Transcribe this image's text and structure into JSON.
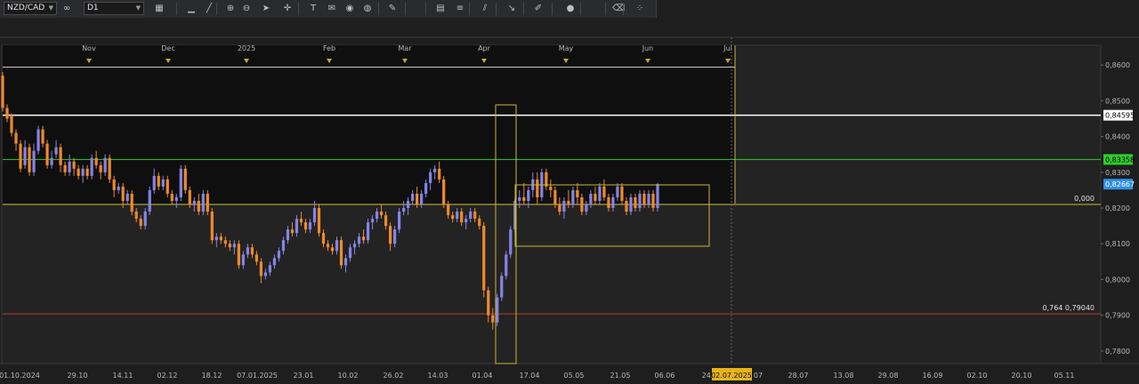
{
  "toolbar": {
    "symbol": "NZD/CAD",
    "timeframe": "D1",
    "icons": [
      "chart-type-icon",
      "line-tool-icon",
      "trendline-icon",
      "zoom-in-icon",
      "zoom-out-icon",
      "cursor-icon",
      "crosshair-icon",
      "text-icon",
      "note-icon",
      "color-icon",
      "globe-icon",
      "pencil-icon",
      "template-icon",
      "fibonacci-icon",
      "channel-icon",
      "arrow-icon",
      "pen-icon",
      "circle-icon",
      "eraser-icon",
      "indicator-icon"
    ]
  },
  "colors": {
    "background": "#1e1e1e",
    "bull": "#8484e8",
    "bear": "#ef8a2a",
    "white_line": "#ffffff",
    "green_line": "#2ecc2e",
    "red_line": "#c0392b",
    "yellow": "#c9b73a",
    "blue_label": "#2f8fe8"
  },
  "top_axis": [
    "Nov",
    "Dec",
    "2025",
    "Feb",
    "Mar",
    "Apr",
    "May",
    "Jun",
    "Jul"
  ],
  "bottom_axis": [
    "01.10.2024",
    "29.10",
    "14.11",
    "02.12",
    "18.12",
    "07.01.2025",
    "23.01",
    "10.02",
    "26.02",
    "14.03",
    "01.04",
    "17.04",
    "05.05",
    "21.05",
    "06.06",
    "24.",
    "07",
    "28.07",
    "13.08",
    "29.08",
    "16.09",
    "02.10",
    "20.10",
    "05.11"
  ],
  "cursor_date": "02.07.2025",
  "price_labels": [
    "0,8600",
    "0,8500",
    "0,8400",
    "0,8300",
    "0,8200",
    "0,8100",
    "0,8000",
    "0,7900",
    "0,7800"
  ],
  "level_labels": {
    "white": "0,84595",
    "green": "0,83358",
    "current": "0,82667",
    "zero": "0,000",
    "fib": "0,764 0,79040"
  },
  "chart_data": {
    "type": "candlestick",
    "symbol": "NZD/CAD",
    "timeframe": "D1",
    "ylim": [
      0.7765,
      0.8655
    ],
    "candles": [
      [
        0.857,
        0.858,
        0.847,
        0.848
      ],
      [
        0.848,
        0.849,
        0.844,
        0.845
      ],
      [
        0.846,
        0.8465,
        0.84,
        0.841
      ],
      [
        0.841,
        0.842,
        0.836,
        0.838
      ],
      [
        0.838,
        0.839,
        0.83,
        0.831
      ],
      [
        0.832,
        0.839,
        0.831,
        0.837
      ],
      [
        0.837,
        0.838,
        0.829,
        0.83
      ],
      [
        0.83,
        0.838,
        0.829,
        0.836
      ],
      [
        0.836,
        0.843,
        0.835,
        0.842
      ],
      [
        0.842,
        0.843,
        0.837,
        0.838
      ],
      [
        0.838,
        0.839,
        0.831,
        0.832
      ],
      [
        0.832,
        0.836,
        0.831,
        0.834
      ],
      [
        0.835,
        0.839,
        0.834,
        0.837
      ],
      [
        0.837,
        0.838,
        0.83,
        0.832
      ],
      [
        0.832,
        0.833,
        0.829,
        0.83
      ],
      [
        0.83,
        0.835,
        0.829,
        0.833
      ],
      [
        0.833,
        0.834,
        0.829,
        0.831
      ],
      [
        0.831,
        0.832,
        0.828,
        0.829
      ],
      [
        0.829,
        0.832,
        0.827,
        0.831
      ],
      [
        0.831,
        0.832,
        0.828,
        0.829
      ],
      [
        0.829,
        0.835,
        0.828,
        0.834
      ],
      [
        0.834,
        0.836,
        0.831,
        0.832
      ],
      [
        0.832,
        0.833,
        0.828,
        0.83
      ],
      [
        0.83,
        0.835,
        0.829,
        0.834
      ],
      [
        0.834,
        0.835,
        0.827,
        0.828
      ],
      [
        0.828,
        0.829,
        0.823,
        0.825
      ],
      [
        0.825,
        0.827,
        0.824,
        0.826
      ],
      [
        0.826,
        0.827,
        0.82,
        0.822
      ],
      [
        0.822,
        0.825,
        0.821,
        0.824
      ],
      [
        0.824,
        0.825,
        0.818,
        0.819
      ],
      [
        0.819,
        0.82,
        0.816,
        0.817
      ],
      [
        0.817,
        0.818,
        0.814,
        0.815
      ],
      [
        0.815,
        0.82,
        0.814,
        0.819
      ],
      [
        0.819,
        0.826,
        0.818,
        0.825
      ],
      [
        0.825,
        0.831,
        0.824,
        0.829
      ],
      [
        0.829,
        0.83,
        0.825,
        0.826
      ],
      [
        0.826,
        0.829,
        0.825,
        0.828
      ],
      [
        0.828,
        0.829,
        0.823,
        0.824
      ],
      [
        0.824,
        0.825,
        0.821,
        0.822
      ],
      [
        0.822,
        0.824,
        0.82,
        0.823
      ],
      [
        0.823,
        0.832,
        0.822,
        0.831
      ],
      [
        0.831,
        0.832,
        0.824,
        0.825
      ],
      [
        0.825,
        0.826,
        0.82,
        0.821
      ],
      [
        0.821,
        0.823,
        0.819,
        0.822
      ],
      [
        0.822,
        0.824,
        0.818,
        0.819
      ],
      [
        0.819,
        0.825,
        0.818,
        0.824
      ],
      [
        0.824,
        0.825,
        0.818,
        0.819
      ],
      [
        0.819,
        0.82,
        0.81,
        0.811
      ],
      [
        0.811,
        0.813,
        0.809,
        0.812
      ],
      [
        0.812,
        0.813,
        0.81,
        0.811
      ],
      [
        0.811,
        0.812,
        0.809,
        0.81
      ],
      [
        0.81,
        0.811,
        0.808,
        0.809
      ],
      [
        0.809,
        0.811,
        0.807,
        0.81
      ],
      [
        0.81,
        0.811,
        0.803,
        0.804
      ],
      [
        0.804,
        0.808,
        0.803,
        0.807
      ],
      [
        0.807,
        0.81,
        0.806,
        0.809
      ],
      [
        0.809,
        0.81,
        0.806,
        0.807
      ],
      [
        0.807,
        0.808,
        0.804,
        0.805
      ],
      [
        0.805,
        0.806,
        0.799,
        0.801
      ],
      [
        0.801,
        0.803,
        0.8,
        0.802
      ],
      [
        0.802,
        0.805,
        0.801,
        0.804
      ],
      [
        0.804,
        0.807,
        0.803,
        0.806
      ],
      [
        0.806,
        0.809,
        0.805,
        0.808
      ],
      [
        0.808,
        0.812,
        0.807,
        0.811
      ],
      [
        0.811,
        0.815,
        0.81,
        0.814
      ],
      [
        0.814,
        0.816,
        0.812,
        0.813
      ],
      [
        0.813,
        0.818,
        0.812,
        0.817
      ],
      [
        0.817,
        0.819,
        0.815,
        0.816
      ],
      [
        0.816,
        0.817,
        0.813,
        0.814
      ],
      [
        0.814,
        0.817,
        0.813,
        0.816
      ],
      [
        0.816,
        0.822,
        0.815,
        0.82
      ],
      [
        0.82,
        0.821,
        0.812,
        0.813
      ],
      [
        0.813,
        0.814,
        0.809,
        0.81
      ],
      [
        0.81,
        0.811,
        0.808,
        0.809
      ],
      [
        0.809,
        0.81,
        0.807,
        0.808
      ],
      [
        0.808,
        0.812,
        0.807,
        0.811
      ],
      [
        0.811,
        0.812,
        0.803,
        0.804
      ],
      [
        0.804,
        0.807,
        0.802,
        0.806
      ],
      [
        0.806,
        0.81,
        0.805,
        0.809
      ],
      [
        0.809,
        0.811,
        0.807,
        0.81
      ],
      [
        0.81,
        0.813,
        0.809,
        0.812
      ],
      [
        0.812,
        0.814,
        0.81,
        0.811
      ],
      [
        0.811,
        0.817,
        0.81,
        0.816
      ],
      [
        0.816,
        0.818,
        0.814,
        0.817
      ],
      [
        0.817,
        0.82,
        0.816,
        0.819
      ],
      [
        0.819,
        0.821,
        0.817,
        0.818
      ],
      [
        0.818,
        0.819,
        0.814,
        0.815
      ],
      [
        0.815,
        0.816,
        0.808,
        0.81
      ],
      [
        0.81,
        0.815,
        0.809,
        0.814
      ],
      [
        0.814,
        0.82,
        0.813,
        0.819
      ],
      [
        0.819,
        0.822,
        0.818,
        0.82
      ],
      [
        0.82,
        0.823,
        0.818,
        0.822
      ],
      [
        0.822,
        0.825,
        0.821,
        0.824
      ],
      [
        0.824,
        0.826,
        0.82,
        0.821
      ],
      [
        0.821,
        0.825,
        0.82,
        0.824
      ],
      [
        0.824,
        0.828,
        0.823,
        0.827
      ],
      [
        0.827,
        0.831,
        0.825,
        0.83
      ],
      [
        0.83,
        0.832,
        0.828,
        0.831
      ],
      [
        0.831,
        0.833,
        0.827,
        0.828
      ],
      [
        0.828,
        0.829,
        0.82,
        0.821
      ],
      [
        0.821,
        0.822,
        0.817,
        0.818
      ],
      [
        0.818,
        0.819,
        0.816,
        0.817
      ],
      [
        0.817,
        0.82,
        0.816,
        0.819
      ],
      [
        0.819,
        0.82,
        0.815,
        0.816
      ],
      [
        0.816,
        0.818,
        0.814,
        0.817
      ],
      [
        0.817,
        0.82,
        0.816,
        0.819
      ],
      [
        0.819,
        0.82,
        0.816,
        0.817
      ],
      [
        0.817,
        0.818,
        0.814,
        0.815
      ],
      [
        0.815,
        0.816,
        0.795,
        0.797
      ],
      [
        0.797,
        0.798,
        0.788,
        0.79
      ],
      [
        0.79,
        0.792,
        0.786,
        0.788
      ],
      [
        0.788,
        0.796,
        0.787,
        0.795
      ],
      [
        0.795,
        0.802,
        0.794,
        0.801
      ],
      [
        0.801,
        0.808,
        0.8,
        0.807
      ],
      [
        0.807,
        0.815,
        0.806,
        0.814
      ],
      [
        0.814,
        0.823,
        0.813,
        0.822
      ],
      [
        0.822,
        0.825,
        0.82,
        0.823
      ],
      [
        0.823,
        0.827,
        0.821,
        0.822
      ],
      [
        0.822,
        0.826,
        0.82,
        0.825
      ],
      [
        0.825,
        0.83,
        0.823,
        0.828
      ],
      [
        0.828,
        0.83,
        0.821,
        0.823
      ],
      [
        0.823,
        0.831,
        0.822,
        0.83
      ],
      [
        0.83,
        0.831,
        0.825,
        0.826
      ],
      [
        0.826,
        0.828,
        0.823,
        0.825
      ],
      [
        0.825,
        0.826,
        0.82,
        0.821
      ],
      [
        0.821,
        0.823,
        0.818,
        0.819
      ],
      [
        0.819,
        0.823,
        0.817,
        0.822
      ],
      [
        0.822,
        0.825,
        0.82,
        0.821
      ],
      [
        0.821,
        0.826,
        0.82,
        0.825
      ],
      [
        0.825,
        0.827,
        0.821,
        0.823
      ],
      [
        0.823,
        0.824,
        0.818,
        0.819
      ],
      [
        0.819,
        0.822,
        0.818,
        0.821
      ],
      [
        0.821,
        0.825,
        0.82,
        0.824
      ],
      [
        0.824,
        0.826,
        0.821,
        0.822
      ],
      [
        0.822,
        0.827,
        0.821,
        0.826
      ],
      [
        0.826,
        0.828,
        0.822,
        0.823
      ],
      [
        0.823,
        0.824,
        0.819,
        0.82
      ],
      [
        0.82,
        0.824,
        0.819,
        0.823
      ],
      [
        0.823,
        0.827,
        0.822,
        0.826
      ],
      [
        0.826,
        0.827,
        0.821,
        0.822
      ],
      [
        0.822,
        0.823,
        0.818,
        0.819
      ],
      [
        0.819,
        0.824,
        0.818,
        0.823
      ],
      [
        0.823,
        0.824,
        0.819,
        0.82
      ],
      [
        0.82,
        0.825,
        0.819,
        0.824
      ],
      [
        0.824,
        0.825,
        0.82,
        0.821
      ],
      [
        0.821,
        0.825,
        0.82,
        0.824
      ],
      [
        0.824,
        0.825,
        0.819,
        0.82
      ],
      [
        0.82,
        0.827,
        0.819,
        0.8267
      ]
    ],
    "levels": [
      {
        "price": 0.84595,
        "color": "white"
      },
      {
        "price": 0.83358,
        "color": "green"
      },
      {
        "price": 0.7904,
        "color": "red",
        "label": "0,764"
      },
      {
        "price": 0.821,
        "color": "yellow",
        "label": "0,000"
      }
    ],
    "current_price": 0.82667
  }
}
